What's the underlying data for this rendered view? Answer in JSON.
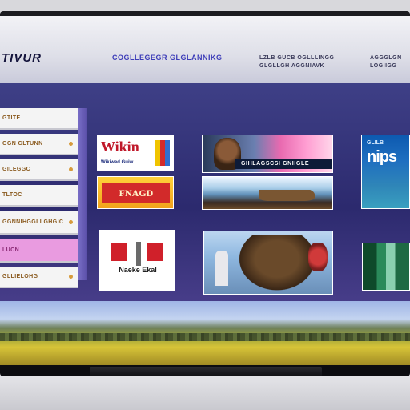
{
  "header": {
    "logo": "TIVUR",
    "nav_main": "COGLLEGEGR GLGLANNIKG",
    "nav_sub1": "LZLB GUCB OGLLLINGG GLGLLGH AGGNIAVK",
    "nav_sub2": "AGGGLGN LOGIIGG"
  },
  "sidebar": {
    "items": [
      {
        "label": "GTITE"
      },
      {
        "label": "GGN GLTUNN"
      },
      {
        "label": "GILEGGC"
      },
      {
        "label": "TLTOC"
      },
      {
        "label": "GGNNIHGGLLGHGIC"
      },
      {
        "label": "LUCN"
      },
      {
        "label": "GLLIELOHG"
      }
    ],
    "active_index": 5
  },
  "tiles": {
    "wiki": {
      "title": "Wikin",
      "subtitle": "Wikiwed Guiw"
    },
    "red": {
      "text": "FNAGD"
    },
    "flag": {
      "caption": "Naeke Ekal"
    },
    "news": {
      "ticker": "GIHLAGSCSI GNIIGLE"
    },
    "map": {
      "header": "GLILB",
      "text": "nips"
    }
  },
  "colors": {
    "accent": "#3c3cb8",
    "active_item": "#e99be0",
    "screen_bg": "#2c2a6e"
  }
}
